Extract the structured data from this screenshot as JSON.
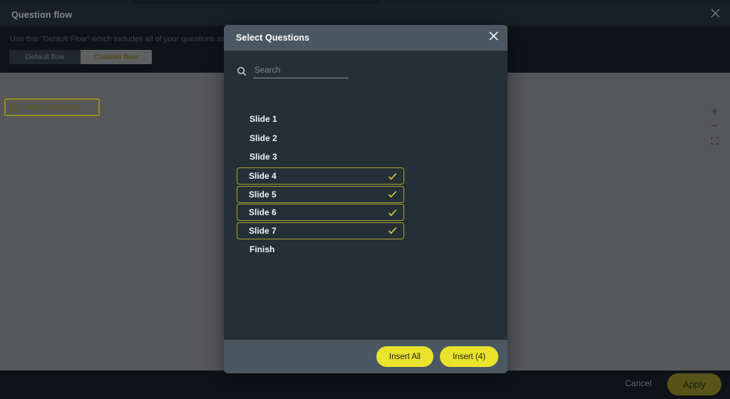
{
  "window": {
    "title": "Question flow",
    "close_icon": "close-icon",
    "description": "Use this \"Default Flow\" which includes all of your questions as basis for you",
    "tabs": [
      {
        "label": "Default flow",
        "active": false
      },
      {
        "label": "Custom flow",
        "active": true
      }
    ],
    "add_question": {
      "label": "Add a Question",
      "icon": "plus-circle-icon",
      "focus_ring_color": "#f2e935"
    },
    "zoom_controls": [
      {
        "name": "zoom-in-button",
        "icon": "plus-icon"
      },
      {
        "name": "zoom-out-button",
        "icon": "minus-icon"
      },
      {
        "name": "fit-screen-button",
        "icon": "expand-icon"
      }
    ],
    "footer": {
      "cancel_label": "Cancel",
      "apply_label": "Apply",
      "apply_color": "#8d8420"
    }
  },
  "modal": {
    "title": "Select Questions",
    "close_icon": "close-icon",
    "search": {
      "placeholder": "Search",
      "value": "",
      "icon": "search-icon"
    },
    "items": [
      {
        "label": "Slide 1",
        "selected": false
      },
      {
        "label": "Slide 2",
        "selected": false
      },
      {
        "label": "Slide 3",
        "selected": false
      },
      {
        "label": "Slide 4",
        "selected": true
      },
      {
        "label": "Slide 5",
        "selected": true
      },
      {
        "label": "Slide 6",
        "selected": true
      },
      {
        "label": "Slide 7",
        "selected": true
      },
      {
        "label": "Finish",
        "selected": false
      }
    ],
    "selected_count": 4,
    "footer": {
      "insert_all_label": "Insert All",
      "insert_label": "Insert (4)",
      "accent_color": "#eae32c"
    }
  },
  "colors": {
    "accent_yellow": "#eae32c",
    "selection_border": "#a8a532",
    "modal_bg": "#262f36",
    "modal_header": "#4b5862",
    "canvas_gray": "#8b8b8b",
    "app_bg": "#14191e"
  }
}
